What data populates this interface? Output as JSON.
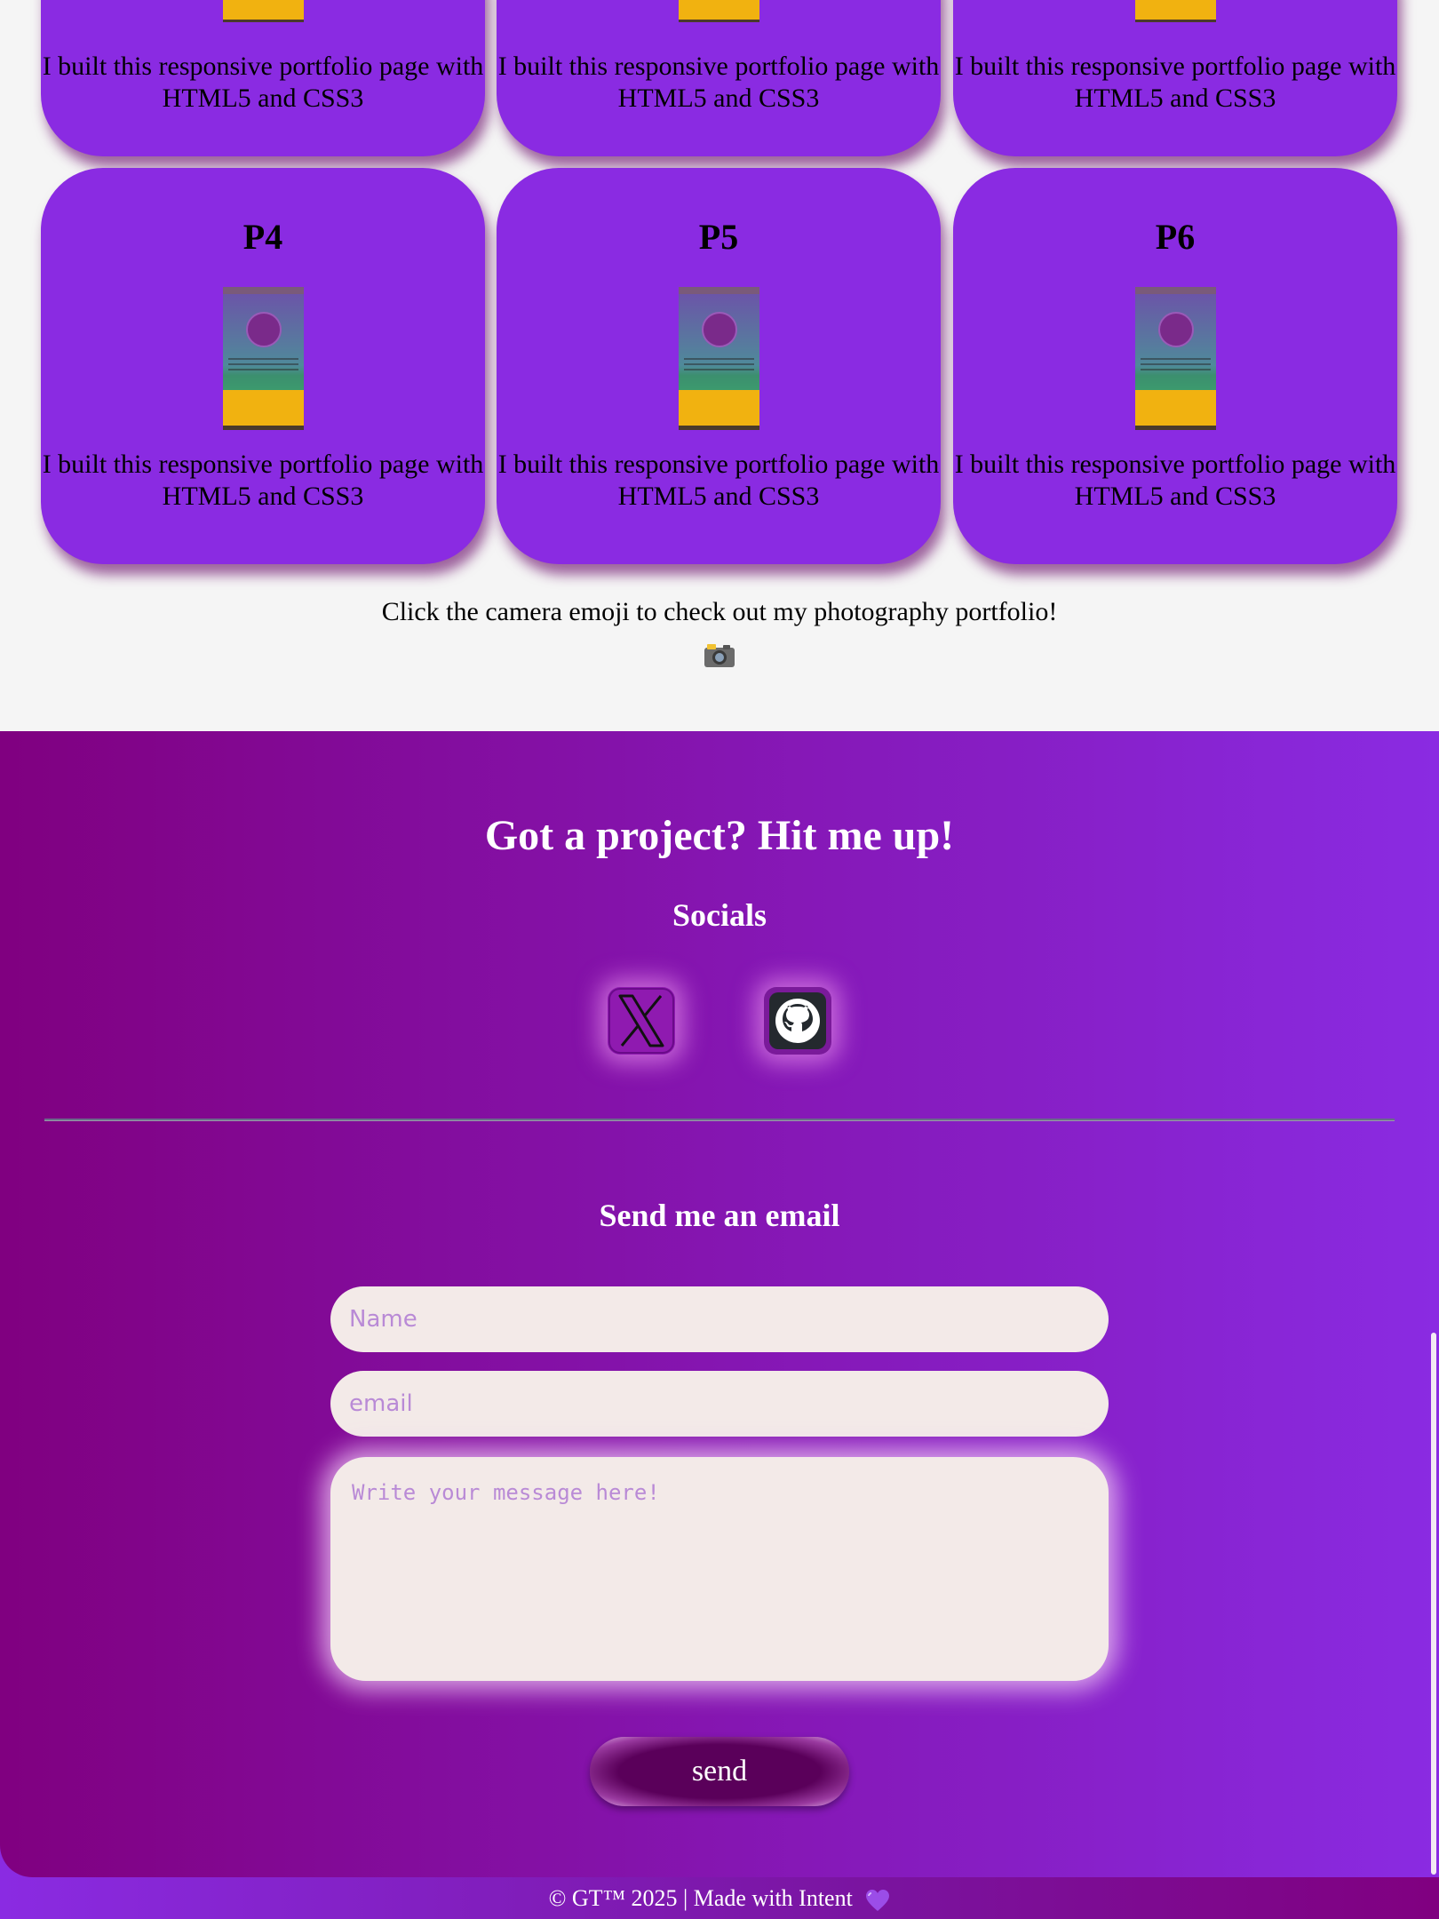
{
  "projects": {
    "cut_description": "I built this responsive portfolio page with HTML5 and CSS3",
    "cards": [
      {
        "title": "P4",
        "description": "I built this responsive portfolio page with HTML5 and CSS3"
      },
      {
        "title": "P5",
        "description": "I built this responsive portfolio page with HTML5 and CSS3"
      },
      {
        "title": "P6",
        "description": "I built this responsive portfolio page with HTML5 and CSS3"
      }
    ],
    "photography_text": "Click the camera emoji to check out my photography portfolio!",
    "camera_icon": "camera-emoji"
  },
  "contact": {
    "heading": "Got a project? Hit me up!",
    "socials_heading": "Socials",
    "socials": [
      {
        "name": "x-icon",
        "color": "#8f1ab0"
      },
      {
        "name": "github-icon",
        "color": "#7a1a9a"
      }
    ],
    "email_heading": "Send me an email",
    "name_placeholder": "Name",
    "email_placeholder": "email",
    "message_placeholder": "Write your message here!",
    "send_label": "send"
  },
  "footer": {
    "text": "© GT™ 2025 | Made with Intent",
    "heart_icon": "purple-heart-icon"
  },
  "colors": {
    "accent": "#8a2be2",
    "deep_purple": "#800080",
    "background": "#f5f5f5"
  }
}
